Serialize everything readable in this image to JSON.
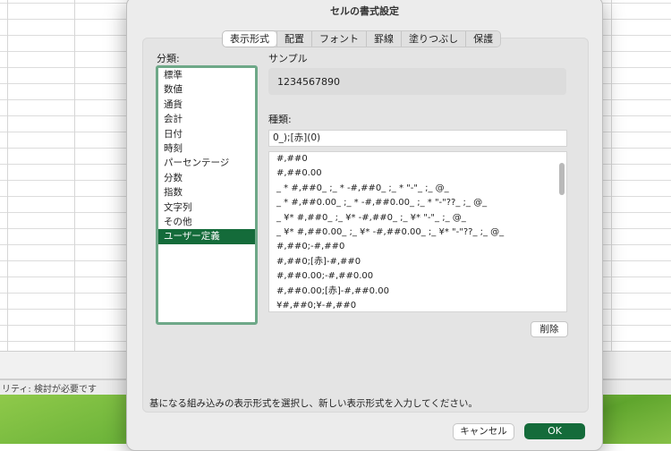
{
  "dialog": {
    "title": "セルの書式設定",
    "tabs": [
      "表示形式",
      "配置",
      "フォント",
      "罫線",
      "塗りつぶし",
      "保護"
    ],
    "selected_tab": "表示形式",
    "category_label": "分類:",
    "categories": [
      "標準",
      "数値",
      "通貨",
      "会計",
      "日付",
      "時刻",
      "パーセンテージ",
      "分数",
      "指数",
      "文字列",
      "その他",
      "ユーザー定義"
    ],
    "selected_category": "ユーザー定義",
    "sample_label": "サンプル",
    "sample_value": "1234567890",
    "type_label": "種類:",
    "format_input_value": "0_);[赤](0)",
    "formats": [
      "#,##0",
      "#,##0.00",
      "_ * #,##0_ ;_ * -#,##0_ ;_ * \"-\"_ ;_ @_",
      "_ * #,##0.00_ ;_ * -#,##0.00_ ;_ * \"-\"??_ ;_ @_",
      "_ ¥* #,##0_ ;_ ¥* -#,##0_ ;_ ¥* \"-\"_ ;_ @_",
      "_ ¥* #,##0.00_ ;_ ¥* -#,##0.00_ ;_ ¥* \"-\"??_ ;_ @_",
      "#,##0;-#,##0",
      "#,##0;[赤]-#,##0",
      "#,##0.00;-#,##0.00",
      "#,##0.00;[赤]-#,##0.00",
      "¥#,##0;¥-#,##0"
    ],
    "delete_label": "削除",
    "hint": "基になる組み込みの表示形式を選択し、新しい表示形式を入力してください。",
    "cancel_label": "キャンセル",
    "ok_label": "OK"
  },
  "background": {
    "status_text": "リティ: 検討が必要です"
  }
}
